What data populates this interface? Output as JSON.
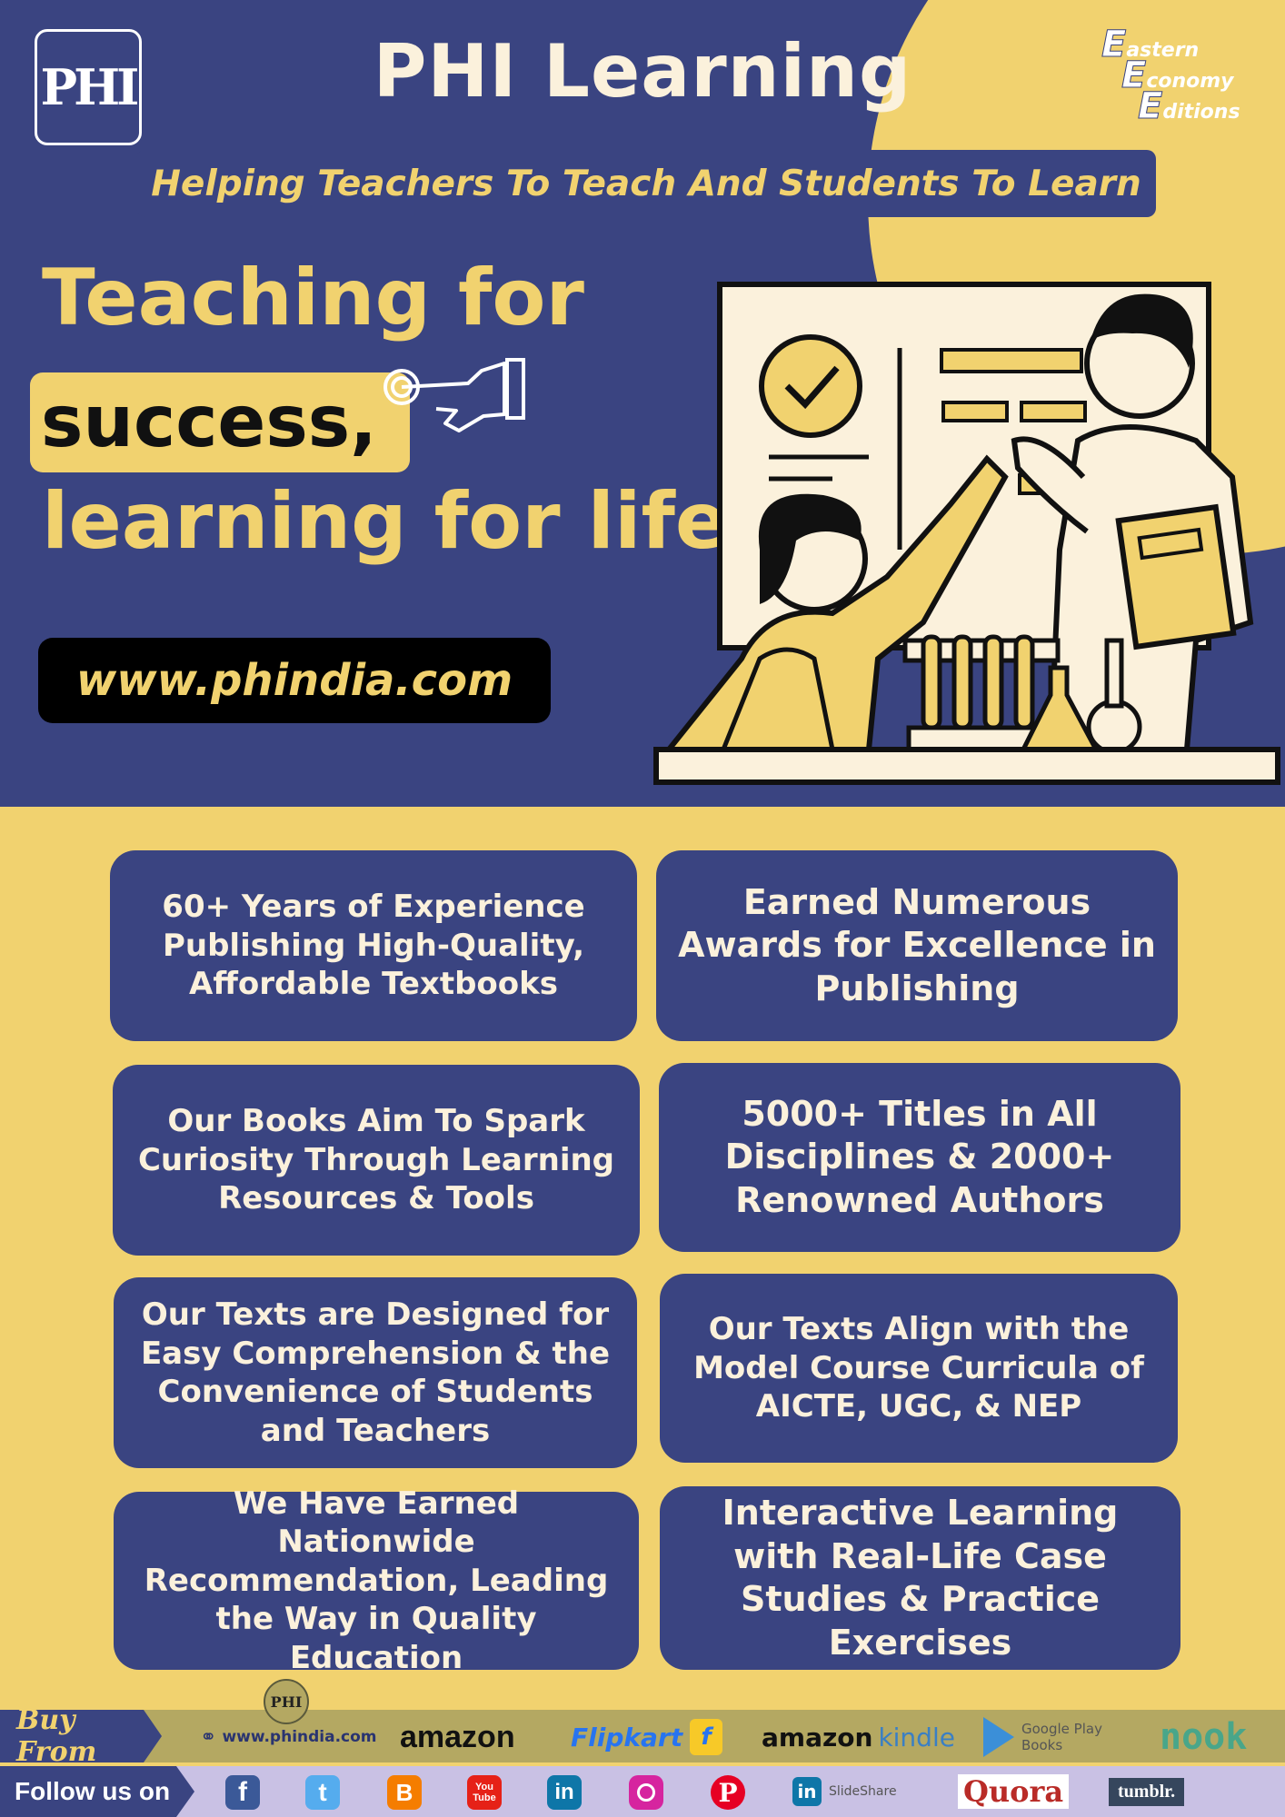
{
  "header": {
    "logo_text": "PHI",
    "brand": "PHI Learning",
    "edition_line1": "astern",
    "edition_line2": "conomy",
    "edition_line3": "ditions",
    "edition_cap": "E",
    "tagline": "Helping Teachers To Teach And Students To Learn"
  },
  "hero": {
    "line1": "Teaching for",
    "line2": "success,",
    "line3": "learning for life",
    "url": "www.phindia.com"
  },
  "features": [
    "60+ Years of Experience Publishing High-Quality, Affordable Textbooks",
    "Earned Numerous Awards for Excellence in Publishing",
    "Our Books Aim To Spark Curiosity Through Learning Resources & Tools",
    "5000+ Titles in All Disciplines & 2000+ Renowned Authors",
    "Our Texts are Designed for Easy Comprehension & the Convenience of Students and Teachers",
    "Our Texts Align with the Model Course Curricula of AICTE, UGC, & NEP",
    "We Have Earned Nationwide Recommendation, Leading the Way in Quality Education",
    "Interactive Learning with Real-Life Case Studies & Practice Exercises"
  ],
  "buy": {
    "label": "Buy From",
    "stores": {
      "phindia": "www.phindia.com",
      "amazon": "amazon",
      "flipkart": "Flipkart",
      "kindle_a": "amazon",
      "kindle_b": "kindle",
      "gplay": "Google Play Books",
      "nook": "nook"
    }
  },
  "follow": {
    "label": "Follow us on",
    "icons": {
      "facebook": "f",
      "twitter": "t",
      "blogger": "B",
      "youtube": "You Tube",
      "linkedin": "in",
      "slideshare": "SlideShare",
      "quora": "Quora",
      "tumblr": "tumblr."
    }
  },
  "colors": {
    "navy": "#3a4481",
    "yellow": "#f1d26f",
    "cream": "#fbf1dc"
  }
}
